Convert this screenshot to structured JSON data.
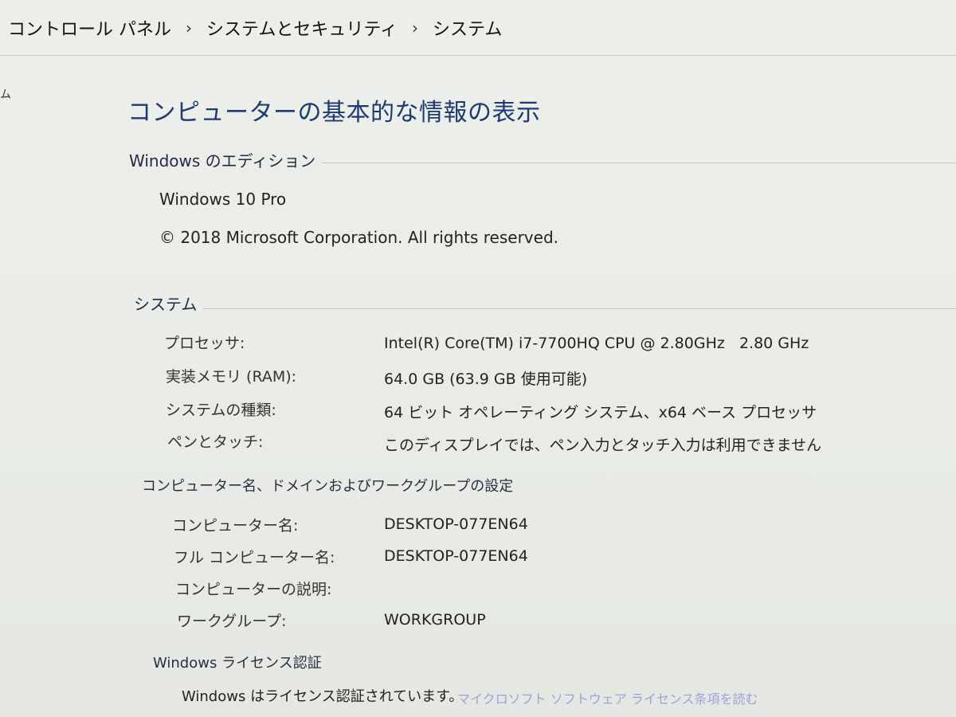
{
  "breadcrumb": {
    "items": [
      "コントロール パネル",
      "システムとセキュリティ",
      "システム"
    ],
    "separator": "›"
  },
  "left_stub": "ム",
  "page_title": "コンピューターの基本的な情報の表示",
  "edition": {
    "heading": "Windows のエディション",
    "name": "Windows 10 Pro",
    "copyright": "© 2018 Microsoft Corporation. All rights reserved."
  },
  "system": {
    "heading": "システム",
    "rows": [
      {
        "label": "プロセッサ:",
        "value": "Intel(R) Core(TM) i7-7700HQ CPU @ 2.80GHz   2.80 GHz"
      },
      {
        "label": "実装メモリ (RAM):",
        "value": "64.0 GB (63.9 GB 使用可能)"
      },
      {
        "label": "システムの種類:",
        "value": "64 ビット オペレーティング システム、x64 ベース プロセッサ"
      },
      {
        "label": "ペンとタッチ:",
        "value": "このディスプレイでは、ペン入力とタッチ入力は利用できません"
      }
    ]
  },
  "computer": {
    "heading": "コンピューター名、ドメインおよびワークグループの設定",
    "rows": [
      {
        "label": "コンピューター名:",
        "value": "DESKTOP-077EN64"
      },
      {
        "label": "フル コンピューター名:",
        "value": "DESKTOP-077EN64"
      },
      {
        "label": "コンピューターの説明:",
        "value": ""
      },
      {
        "label": "ワークグループ:",
        "value": "WORKGROUP"
      }
    ]
  },
  "license": {
    "heading": "Windows ライセンス認証",
    "status": "Windows はライセンス認証されています。",
    "link": "マイクロソフト ソフトウェア ライセンス条項を読む"
  },
  "colors": {
    "title": "#1e3a73",
    "link": "#9aa3d8"
  }
}
